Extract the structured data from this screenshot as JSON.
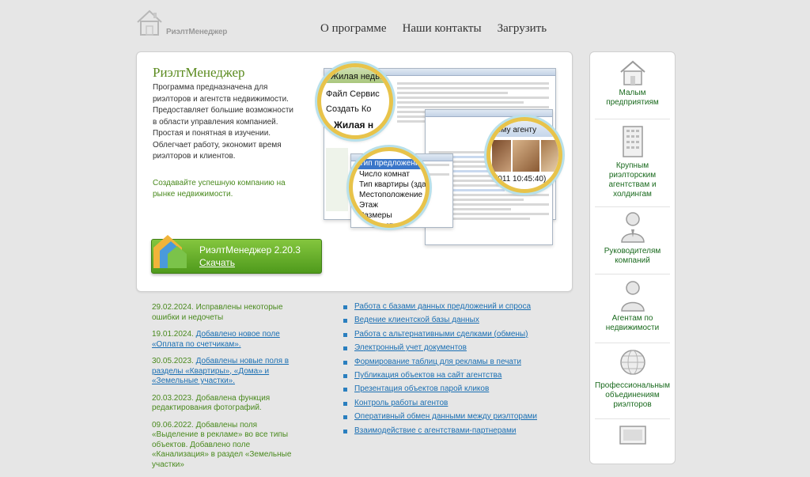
{
  "header": {
    "logo_text": "РиэлтМенеджер",
    "nav": [
      {
        "label": "О программе"
      },
      {
        "label": "Наши контакты"
      },
      {
        "label": "Загрузить"
      }
    ]
  },
  "hero": {
    "title": "РиэлтМенеджер",
    "description": "Программа предназначена для риэлторов и агентств недвижимости. Предоставляет большие возможности в области управления компанией. Простая и понятная в изучении. Облегчает работу, экономит время риэлторов и клиентов.",
    "slogan": "Создавайте успешную компанию на рынке недвижимости.",
    "download": {
      "version": "РиэлтМенеджер 2.20.3",
      "link": "Скачать"
    },
    "mock": {
      "lens1": [
        "Жилая недви",
        "Файл  Сервис",
        "Создать  Ко",
        "Жилая н"
      ],
      "lens2": [
        "Тип предложения",
        "Число комнат",
        "Тип квартиры (зда",
        "Местоположение",
        "Этаж",
        "Размеры",
        "Количест"
      ],
      "lens3": [
        "ому агенту",
        "(011 10:45:40)"
      ]
    }
  },
  "news": [
    {
      "date": "29.02.2024.",
      "text": "Исправлены некоторые ошибки и недочеты",
      "link": ""
    },
    {
      "date": "19.01.2024.",
      "text": "",
      "link": "Добавлено новое поле «Оплата по счетчикам»."
    },
    {
      "date": "30.05.2023.",
      "text": "",
      "link": "Добавлены новые поля в разделы «Квартиры», «Дома» и «Земельные участки»."
    },
    {
      "date": "20.03.2023.",
      "text": "Добавлена функция редактирования фотографий.",
      "link": ""
    },
    {
      "date": "09.06.2022.",
      "text": "Добавлены поля «Выделение в рекламе» во все типы объектов. Добавлено поле «Канализация» в раздел «Земельные участки»",
      "link": ""
    }
  ],
  "features": [
    "Работа с базами данных предложений и спроса",
    "Ведение клиентской базы данных",
    "Работа с альтернативными сделками (обмены)",
    "Электронный учет документов",
    "Формирование таблиц для рекламы в печати",
    "Публикация объектов на сайт агентства",
    "Презентация объектов парой кликов",
    "Контроль работы агентов",
    "Оперативный обмен данными между риэлторами",
    "Взаимодействие с агентствами-партнерами"
  ],
  "sidebar": [
    {
      "label": "Малым предприятиям",
      "icon": "house-icon"
    },
    {
      "label": "Крупным риэлторским агентствам и холдингам",
      "icon": "building-icon"
    },
    {
      "label": "Руководителям компаний",
      "icon": "manager-icon"
    },
    {
      "label": "Агентам по недвижимости",
      "icon": "agent-icon"
    },
    {
      "label": "Профессиональным объединениям риэлторов",
      "icon": "globe-icon"
    },
    {
      "label": "",
      "icon": "monitor-icon"
    }
  ]
}
